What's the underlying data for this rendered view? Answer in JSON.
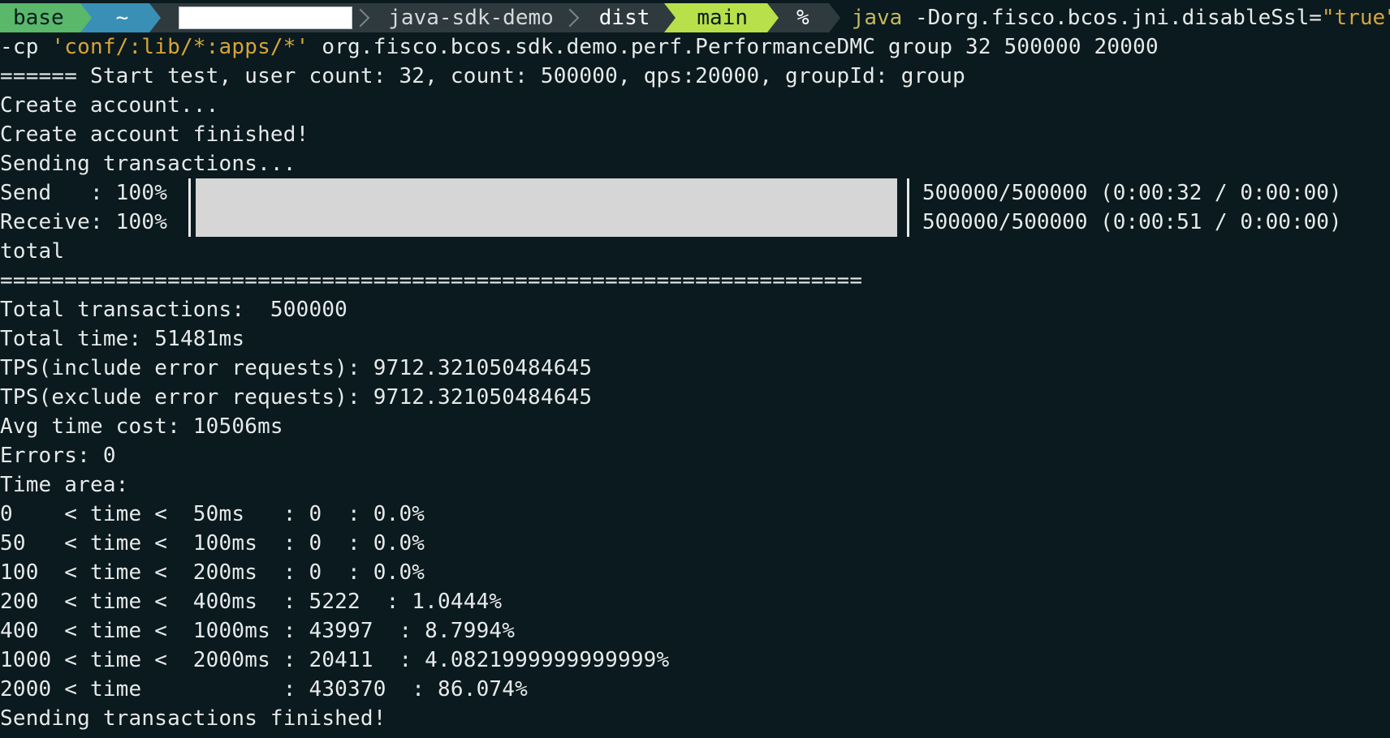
{
  "colors": {
    "background": "#0a1a1e",
    "base_segment": "#59b86a",
    "home_segment": "#3a8fb7",
    "branch_segment": "#b8e04a",
    "dark_segment": "#2f3a3f",
    "java_keyword": "#c4b95a",
    "string_literal": "#d7a43a",
    "progress_fill": "#d6d6d6"
  },
  "prompt": {
    "env": "base",
    "home": "~",
    "user_redacted": "",
    "dir": "java-sdk-demo",
    "subdir": "dist",
    "branch": "main",
    "symbol": "%",
    "command_java": "java",
    "command_flag": " -Dorg.fisco.bcos.jni.disableSsl=",
    "command_flag_value": "\"true\""
  },
  "command_cont": {
    "prefix": "-cp ",
    "classpath": "'conf/:lib/*:apps/*'",
    "rest": " org.fisco.bcos.sdk.demo.perf.PerformanceDMC group 32 500000 20000"
  },
  "output": {
    "start": "====== Start test, user count: 32, count: 500000, qps:20000, groupId: group",
    "create": "Create account...",
    "create_done": "Create account finished!",
    "sending": "Sending transactions...",
    "send_label": "Send   : 100%",
    "receive_label": "Receive: 100%",
    "send_progress": "500000/500000 (0:00:32 / 0:00:00)",
    "receive_progress": "500000/500000 (0:00:51 / 0:00:00)",
    "send_percent": 100,
    "receive_percent": 100,
    "total": "total",
    "divider": "===================================================================",
    "total_tx": "Total transactions:  500000",
    "total_time": "Total time: 51481ms",
    "tps_incl": "TPS(include error requests): 9712.321050484645",
    "tps_excl": "TPS(exclude error requests): 9712.321050484645",
    "avg": "Avg time cost: 10506ms",
    "errors": "Errors: 0",
    "time_area": "Time area:",
    "areas": [
      "0    < time <  50ms   : 0  : 0.0%",
      "50   < time <  100ms  : 0  : 0.0%",
      "100  < time <  200ms  : 0  : 0.0%",
      "200  < time <  400ms  : 5222  : 1.0444%",
      "400  < time <  1000ms : 43997  : 8.7994%",
      "1000 < time <  2000ms : 20411  : 4.0821999999999999%",
      "2000 < time           : 430370  : 86.074%"
    ],
    "finished": "Sending transactions finished!"
  }
}
